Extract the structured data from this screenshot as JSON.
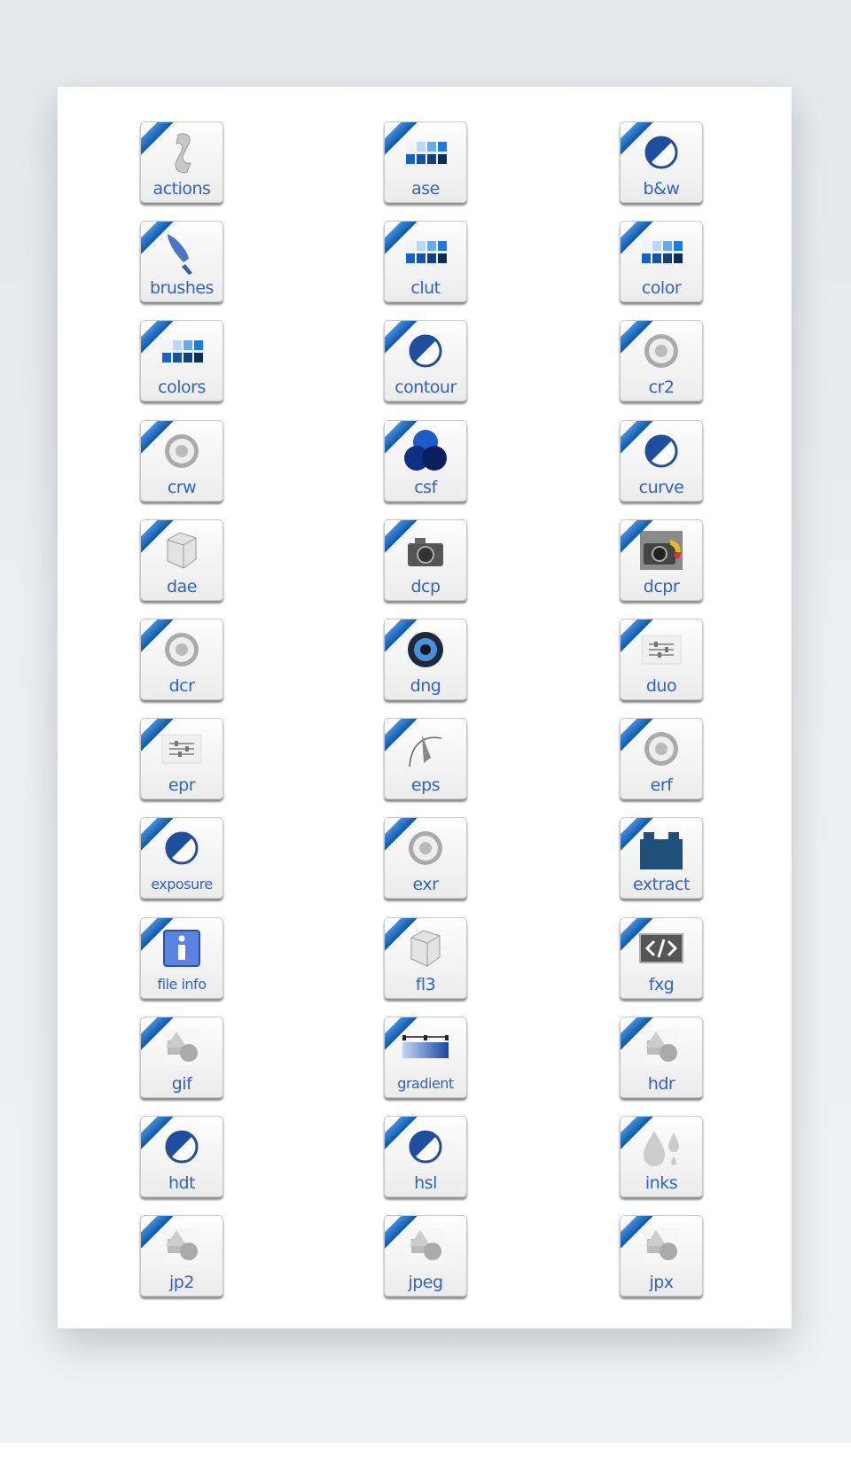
{
  "accent_color": "#1f66c2",
  "label_color": "#2f63c4",
  "icons": [
    {
      "label": "actions",
      "icon": "scroll-icon"
    },
    {
      "label": "ase",
      "icon": "swatches-icon"
    },
    {
      "label": "b&w",
      "icon": "half-circle-icon"
    },
    {
      "label": "brushes",
      "icon": "brush-icon"
    },
    {
      "label": "clut",
      "icon": "swatches-icon"
    },
    {
      "label": "color",
      "icon": "swatches-icon"
    },
    {
      "label": "colors",
      "icon": "swatches-icon"
    },
    {
      "label": "contour",
      "icon": "half-circle-icon"
    },
    {
      "label": "cr2",
      "icon": "aperture-icon"
    },
    {
      "label": "crw",
      "icon": "aperture-icon"
    },
    {
      "label": "csf",
      "icon": "circles-icon"
    },
    {
      "label": "curve",
      "icon": "half-circle-icon"
    },
    {
      "label": "dae",
      "icon": "cube-icon"
    },
    {
      "label": "dcp",
      "icon": "camera-icon"
    },
    {
      "label": "dcpr",
      "icon": "camera-color-icon"
    },
    {
      "label": "dcr",
      "icon": "aperture-icon"
    },
    {
      "label": "dng",
      "icon": "aperture-dark-icon"
    },
    {
      "label": "duo",
      "icon": "sliders-icon"
    },
    {
      "label": "epr",
      "icon": "sliders-icon"
    },
    {
      "label": "eps",
      "icon": "pen-curve-icon"
    },
    {
      "label": "erf",
      "icon": "aperture-icon"
    },
    {
      "label": "exposure",
      "icon": "half-circle-icon"
    },
    {
      "label": "exr",
      "icon": "aperture-icon"
    },
    {
      "label": "extract",
      "icon": "brick-icon"
    },
    {
      "label": "file info",
      "icon": "info-icon"
    },
    {
      "label": "fl3",
      "icon": "cube-icon"
    },
    {
      "label": "fxg",
      "icon": "code-icon"
    },
    {
      "label": "gif",
      "icon": "shapes-icon"
    },
    {
      "label": "gradient",
      "icon": "gradient-icon"
    },
    {
      "label": "hdr",
      "icon": "shapes-icon"
    },
    {
      "label": "hdt",
      "icon": "half-circle-icon"
    },
    {
      "label": "hsl",
      "icon": "half-circle-icon"
    },
    {
      "label": "inks",
      "icon": "drops-icon"
    },
    {
      "label": "jp2",
      "icon": "shapes-icon"
    },
    {
      "label": "jpeg",
      "icon": "shapes-icon"
    },
    {
      "label": "jpx",
      "icon": "shapes-icon"
    }
  ]
}
